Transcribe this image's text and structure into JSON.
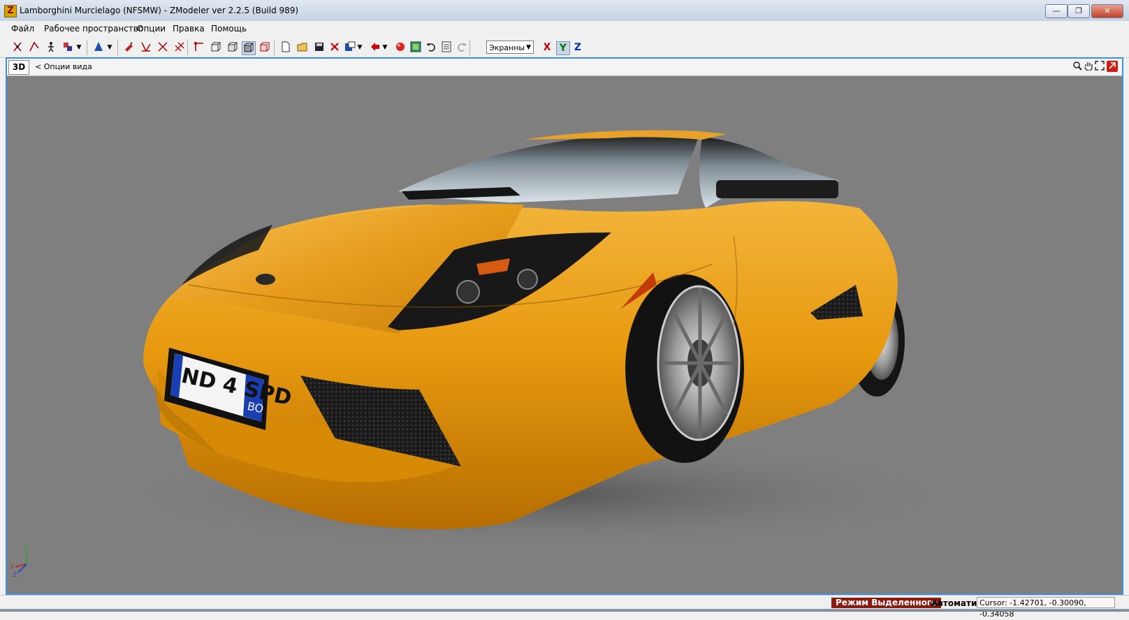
{
  "window": {
    "title": "Lamborghini Murcielago  (NFSMW) - ZModeler ver 2.2.5 (Build 989)",
    "app_icon_letter": "Z",
    "minimize_glyph": "—",
    "maximize_glyph": "❐",
    "close_glyph": "✕"
  },
  "menu": {
    "items": [
      {
        "label": "Файл"
      },
      {
        "label": "Рабочее пространство"
      },
      {
        "label": "Опции"
      },
      {
        "label": "Правка"
      },
      {
        "label": "Помощь"
      }
    ]
  },
  "toolbar": {
    "view_mode_value": "Экранны",
    "axes": [
      {
        "label": "X",
        "color": "#cc0000"
      },
      {
        "label": "Y",
        "color": "#007a00"
      },
      {
        "label": "Z",
        "color": "#0033aa"
      }
    ]
  },
  "viewport": {
    "mode_label": "3D",
    "options_label": "<  Опции вида",
    "axis_y": "Y",
    "axis_x": "X",
    "axis_z": "Z"
  },
  "plate": {
    "number": "ND 4 SPD",
    "region": "BO"
  },
  "status": {
    "mode": "Режим Выделенного",
    "auto": "Автоматич.",
    "cursor": "Cursor: -1.42701, -0.30090, -0.34058"
  }
}
